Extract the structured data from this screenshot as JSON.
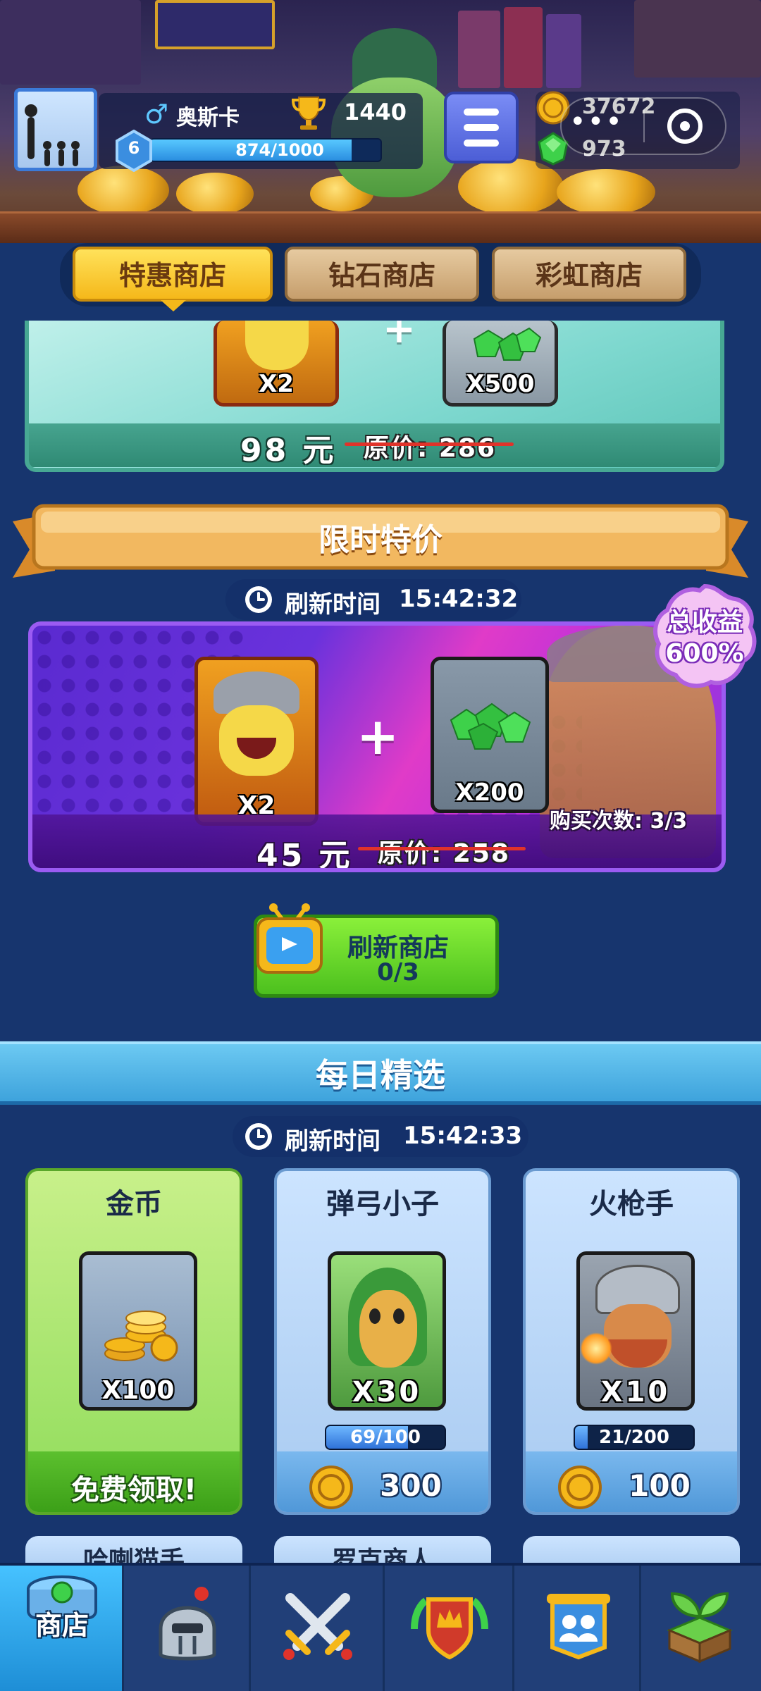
{
  "header": {
    "player_name": "奥斯卡",
    "gender_symbol": "♂",
    "trophies": "1440",
    "level": "6",
    "xp_text": "874/1000",
    "xp_fraction": 0.874,
    "coins": "37672",
    "gems": "973",
    "capsule_more": "•••"
  },
  "tabs": [
    {
      "label": "特惠商店",
      "active": true
    },
    {
      "label": "钻石商店",
      "active": false
    },
    {
      "label": "彩虹商店",
      "active": false
    }
  ],
  "offer_1": {
    "hero_qty": "X2",
    "gem_qty": "X500",
    "price": "98 元",
    "original_price": "原价: 286"
  },
  "limited": {
    "title": "限时特价",
    "refresh_label": "刷新时间",
    "refresh_time": "15:42:32",
    "profit_line1": "总收益",
    "profit_line2": "600%",
    "hero_qty": "X2",
    "gem_qty": "X200",
    "purchase_count": "购买次数: 3/3",
    "price": "45 元",
    "original_price": "原价: 258"
  },
  "refresh_shop": {
    "label": "刷新商店",
    "count": "0/3"
  },
  "daily": {
    "title": "每日精选",
    "refresh_label": "刷新时间",
    "refresh_time": "15:42:33",
    "products": [
      {
        "name": "金币",
        "qty": "X100",
        "footer": "免费领取!",
        "kind": "free"
      },
      {
        "name": "弹弓小子",
        "qty": "X30",
        "progress": "69/100",
        "progress_fraction": 0.69,
        "cost": "300",
        "kind": "buy"
      },
      {
        "name": "火枪手",
        "qty": "X10",
        "progress": "21/200",
        "progress_fraction": 0.105,
        "cost": "100",
        "kind": "buy"
      }
    ],
    "next_row_peek": [
      "哈喇猫手",
      "罗克商人",
      ""
    ]
  },
  "nav": {
    "shop_label": "商店",
    "items": [
      "shop",
      "heroes",
      "battle",
      "arena",
      "guild",
      "garden"
    ]
  },
  "colors": {
    "background": "#17356e",
    "tab_active": "#f5b81a",
    "tab_inactive": "#c69e6c",
    "refresh_green": "#4cc01e",
    "daily_blue": "#3ea3dc"
  }
}
